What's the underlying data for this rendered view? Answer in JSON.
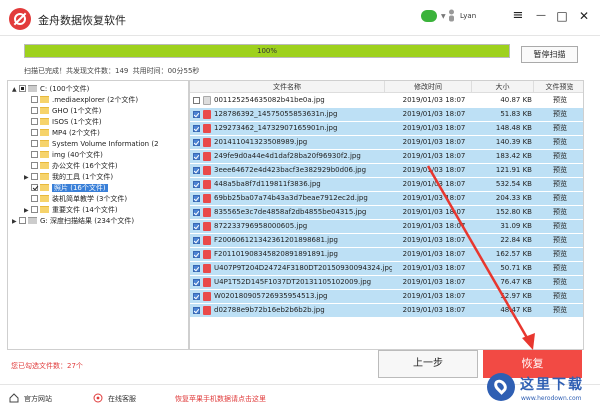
{
  "window": {
    "title": "金舟数据恢复软件",
    "username": "Lyan",
    "controls": [
      "≡",
      "—",
      "□",
      "✕"
    ]
  },
  "scan": {
    "progress_percent": 100,
    "progress_label": "100%",
    "pause_label": "暂停扫描",
    "status_text": "扫描已完成！共发现文件数：149   共用时间：00分55秒"
  },
  "tree": [
    {
      "label": "C:  (100个文件)",
      "icon": "drive-icon",
      "indent": 0,
      "expander": "▲",
      "check": "partial"
    },
    {
      "label": ".mediaexplorer  (2个文件)",
      "icon": "folder-icon",
      "indent": 1,
      "expander": "",
      "check": "none"
    },
    {
      "label": "GHO  (1个文件)",
      "icon": "folder-icon",
      "indent": 1,
      "expander": "",
      "check": "none"
    },
    {
      "label": "ISOS  (1个文件)",
      "icon": "folder-icon",
      "indent": 1,
      "expander": "",
      "check": "none"
    },
    {
      "label": "MP4  (2个文件)",
      "icon": "folder-icon",
      "indent": 1,
      "expander": "",
      "check": "none"
    },
    {
      "label": "System Volume Information  (2",
      "icon": "folder-icon",
      "indent": 1,
      "expander": "",
      "check": "none"
    },
    {
      "label": "img  (40个文件)",
      "icon": "folder-icon",
      "indent": 1,
      "expander": "",
      "check": "none"
    },
    {
      "label": "办公文件  (16个文件)",
      "icon": "folder-icon",
      "indent": 1,
      "expander": "",
      "check": "none"
    },
    {
      "label": "我的工具  (1个文件)",
      "icon": "folder-icon",
      "indent": 1,
      "expander": "▶",
      "check": "none"
    },
    {
      "label": "照片  (16个文件)",
      "icon": "folder-icon",
      "indent": 1,
      "expander": "",
      "check": "checked",
      "selected": true
    },
    {
      "label": "装机简单教学  (3个文件)",
      "icon": "folder-icon",
      "indent": 1,
      "expander": "",
      "check": "none"
    },
    {
      "label": "重要文件  (14个文件)",
      "icon": "folder-icon",
      "indent": 1,
      "expander": "▶",
      "check": "none"
    },
    {
      "label": "G: 深度扫描结果  (234个文件)",
      "icon": "drive-icon",
      "indent": 0,
      "expander": "▶",
      "check": "none"
    }
  ],
  "table": {
    "headers": [
      "文件名称",
      "修改时间",
      "大小",
      "文件预览"
    ],
    "rows": [
      {
        "name": "001125254635082b41be0a.jpg",
        "time": "2019/01/03 18:07",
        "size": "40.87 KB",
        "preview": "预览",
        "checked": false,
        "highlight": false
      },
      {
        "name": "128786392_14575055853631n.jpg",
        "time": "2019/01/03 18:07",
        "size": "51.83 KB",
        "preview": "预览",
        "checked": true,
        "highlight": true
      },
      {
        "name": "129273462_14732907165901n.jpg",
        "time": "2019/01/03 18:07",
        "size": "148.48 KB",
        "preview": "预览",
        "checked": true,
        "highlight": true
      },
      {
        "name": "201411041323508989.jpg",
        "time": "2019/01/03 18:07",
        "size": "140.39 KB",
        "preview": "预览",
        "checked": true,
        "highlight": true
      },
      {
        "name": "249fe9d0a44e4d1daf28ba20f96930f2.jpg",
        "time": "2019/01/03 18:07",
        "size": "183.42 KB",
        "preview": "预览",
        "checked": true,
        "highlight": true
      },
      {
        "name": "3eee64672e4d423bacf3e382929b0d06.jpg",
        "time": "2019/01/03 18:07",
        "size": "121.91 KB",
        "preview": "预览",
        "checked": true,
        "highlight": true
      },
      {
        "name": "448a5ba8f7d119811f3836.jpg",
        "time": "2019/01/03 18:07",
        "size": "532.54 KB",
        "preview": "预览",
        "checked": true,
        "highlight": true
      },
      {
        "name": "69bb25ba07a74b43a3d7beae7912ec2d.jpg",
        "time": "2019/01/03 18:07",
        "size": "204.33 KB",
        "preview": "预览",
        "checked": true,
        "highlight": true
      },
      {
        "name": "835565e3c7de4858af2db4855be04315.jpg",
        "time": "2019/01/03 18:07",
        "size": "152.80 KB",
        "preview": "预览",
        "checked": true,
        "highlight": true
      },
      {
        "name": "872233796958000605.jpg",
        "time": "2019/01/03 18:07",
        "size": "31.09 KB",
        "preview": "预览",
        "checked": true,
        "highlight": true
      },
      {
        "name": "F200606121342361201898681.jpg",
        "time": "2019/01/03 18:07",
        "size": "22.84 KB",
        "preview": "预览",
        "checked": true,
        "highlight": true
      },
      {
        "name": "F201101908345820891891891.jpg",
        "time": "2019/01/03 18:07",
        "size": "162.57 KB",
        "preview": "预览",
        "checked": true,
        "highlight": true
      },
      {
        "name": "U407P9T204D24724F3180DT20150930094324.jpg",
        "time": "2019/01/03 18:07",
        "size": "50.71 KB",
        "preview": "预览",
        "checked": true,
        "highlight": true
      },
      {
        "name": "U4P1T52D145F1037DT20131105102009.jpg",
        "time": "2019/01/03 18:07",
        "size": "76.47 KB",
        "preview": "预览",
        "checked": true,
        "highlight": true
      },
      {
        "name": "W020180905726935954513.jpg",
        "time": "2019/01/03 18:07",
        "size": "52.97 KB",
        "preview": "预览",
        "checked": true,
        "highlight": true
      },
      {
        "name": "d02788e9b72b16eb2b6b2b.jpg",
        "time": "2019/01/03 18:07",
        "size": "48.47 KB",
        "preview": "预览",
        "checked": true,
        "highlight": true
      }
    ]
  },
  "bottom": {
    "selected_count": "您已勾选文件数：27个",
    "prev_label": "上一步",
    "recover_label": "恢复"
  },
  "footer": {
    "official_site": "官方网站",
    "online_support": "在线客服",
    "ios_promo": "恢复苹果手机数据请点击这里"
  },
  "watermark": {
    "title": "这里下载",
    "url": "www.herodown.com"
  },
  "colors": {
    "accent_red": "#f24a44",
    "progress_green": "#9ed11d",
    "row_highlight": "#bde0f5",
    "brand_blue": "#2f5fb3"
  }
}
